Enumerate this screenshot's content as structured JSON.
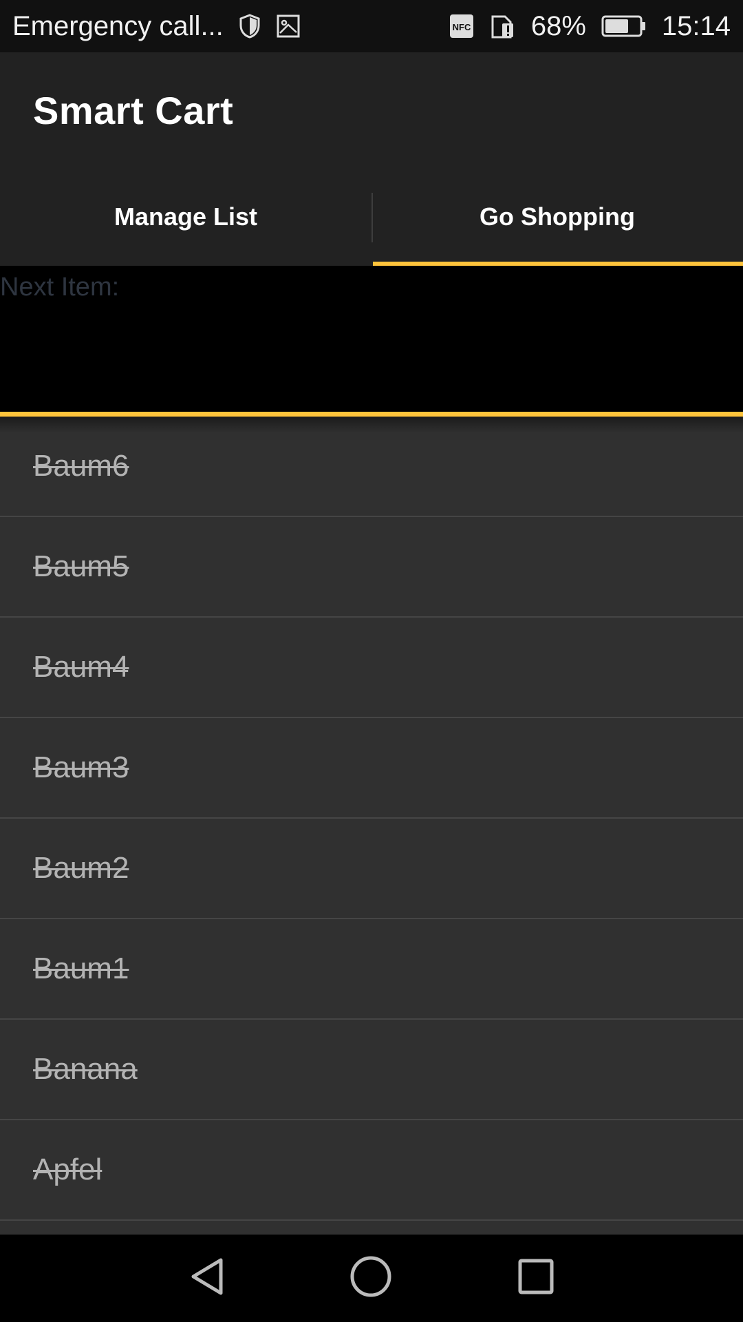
{
  "status_bar": {
    "carrier_text": "Emergency call...",
    "nfc_label": "NFC",
    "battery_percent": "68%",
    "battery_level": 0.68,
    "time": "15:14"
  },
  "app": {
    "title": "Smart Cart"
  },
  "tabs": [
    {
      "label": "Manage List",
      "active": false
    },
    {
      "label": "Go Shopping",
      "active": true
    }
  ],
  "next_item": {
    "label": "Next Item:"
  },
  "items": [
    {
      "label": "Baum6",
      "done": true
    },
    {
      "label": "Baum5",
      "done": true
    },
    {
      "label": "Baum4",
      "done": true
    },
    {
      "label": "Baum3",
      "done": true
    },
    {
      "label": "Baum2",
      "done": true
    },
    {
      "label": "Baum1",
      "done": true
    },
    {
      "label": "Banana",
      "done": true
    },
    {
      "label": "Apfel",
      "done": true
    }
  ],
  "colors": {
    "accent": "#ffc43b",
    "appbar": "#222222",
    "list_bg": "#303030"
  },
  "nav": {
    "icons": [
      "back-icon",
      "home-icon",
      "recents-icon"
    ]
  }
}
